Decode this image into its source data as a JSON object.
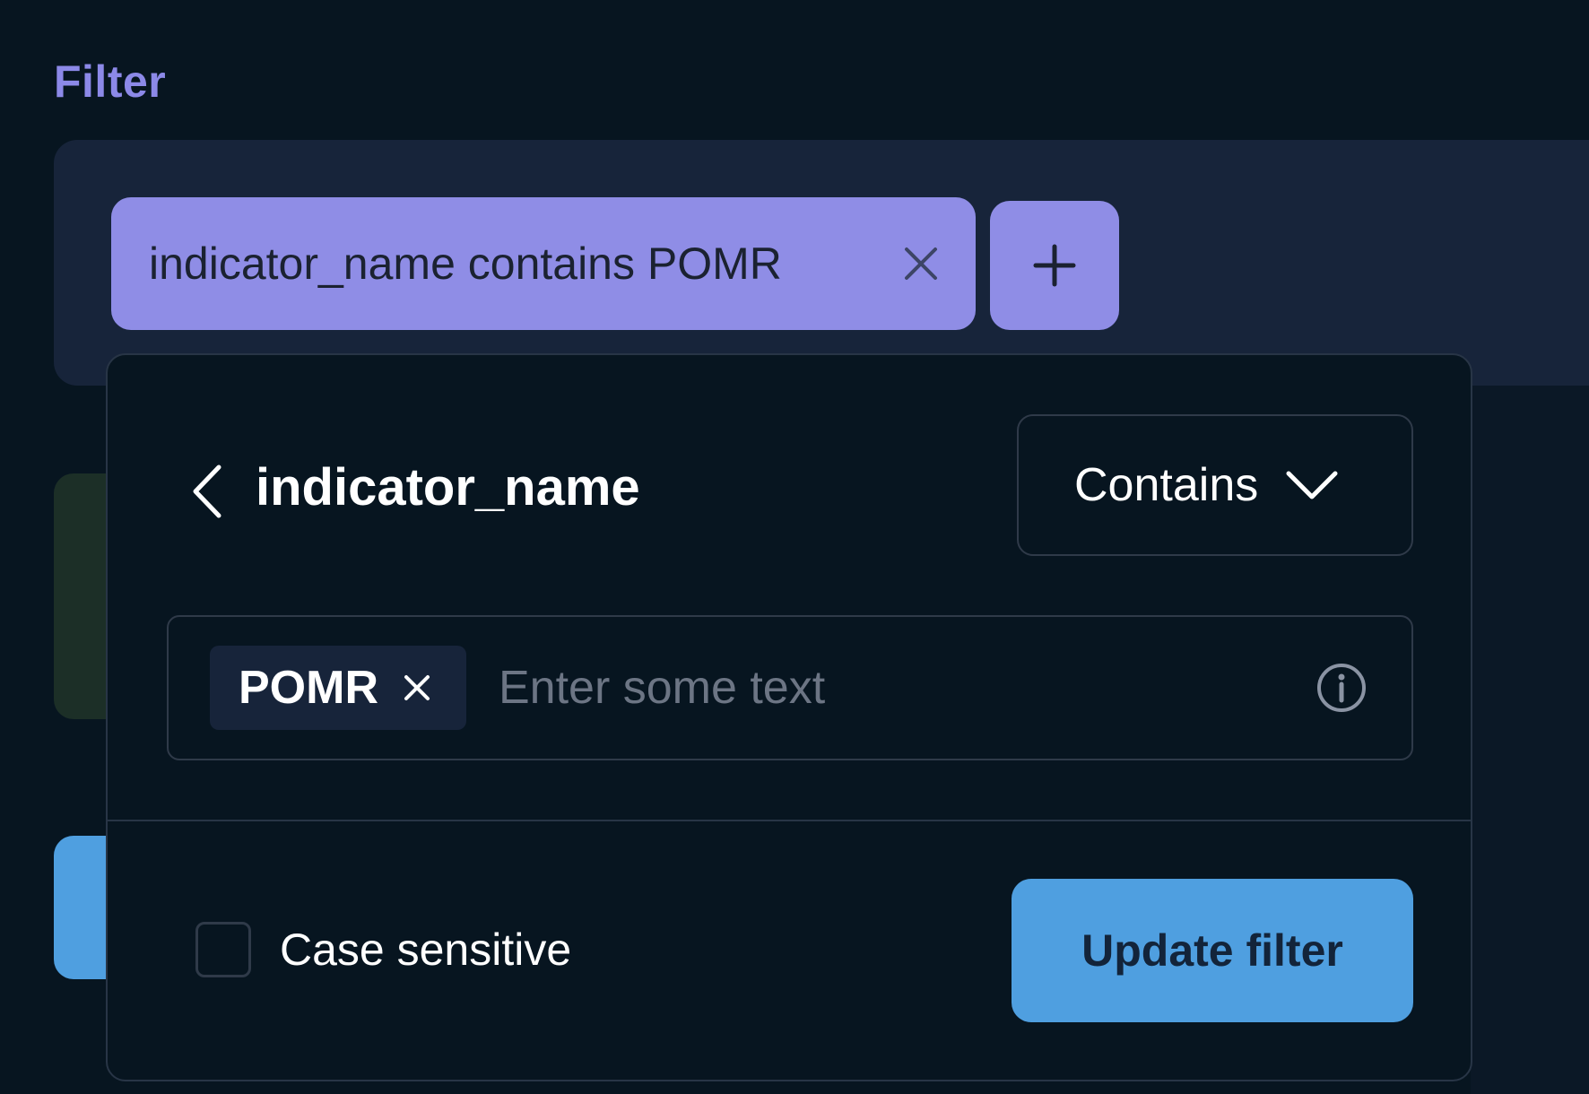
{
  "section": {
    "title": "Filter"
  },
  "filter_chip": {
    "label": "indicator_name contains POMR",
    "remove_icon": "close-icon"
  },
  "add_filter": {
    "icon": "plus-icon"
  },
  "popover": {
    "back_icon": "chevron-left-icon",
    "column_name": "indicator_name",
    "operator": {
      "selected": "Contains",
      "icon": "chevron-down-icon"
    },
    "value_input": {
      "tags": [
        {
          "label": "POMR"
        }
      ],
      "placeholder": "Enter some text",
      "info_icon": "info-icon"
    },
    "case_sensitive": {
      "label": "Case sensitive",
      "checked": false
    },
    "update_button": {
      "label": "Update filter"
    }
  },
  "colors": {
    "background": "#071520",
    "panel": "#17243a",
    "accent_purple": "#8f8de6",
    "title_purple": "#8c89e8",
    "primary_blue": "#4f9fe0",
    "border": "#2f3a49",
    "muted_text": "#6c7584"
  }
}
